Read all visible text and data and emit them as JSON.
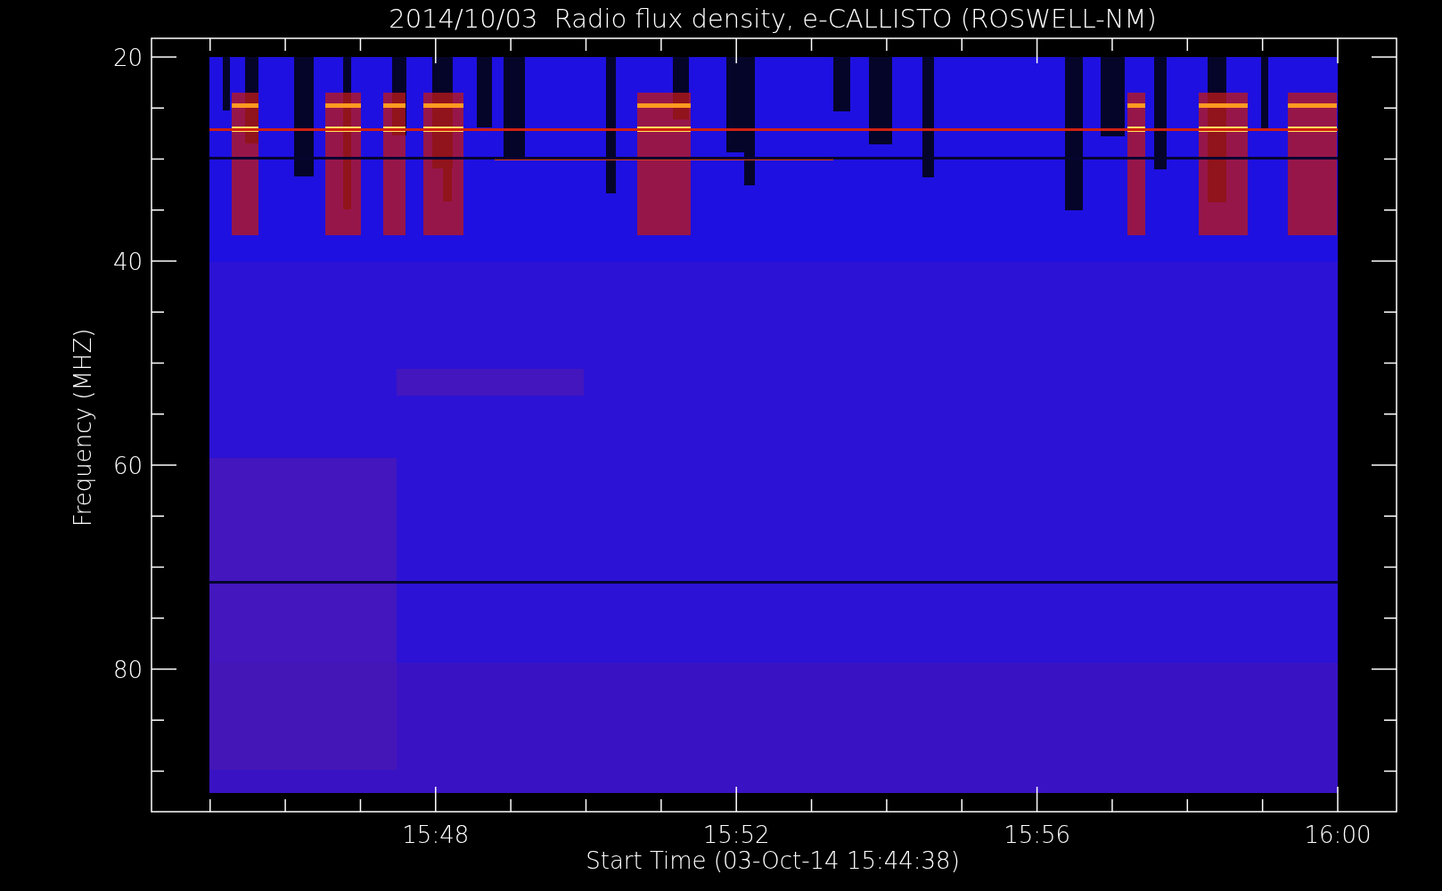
{
  "title": "2014/10/03  Radio flux density, e-CALLISTO (ROSWELL-NM)",
  "y_axis": {
    "label": "Frequency (MHZ)",
    "ticks": [
      "20",
      "40",
      "60",
      "80"
    ]
  },
  "x_axis": {
    "label": "Start Time (03-Oct-14 15:44:38)",
    "ticks": [
      "15:48",
      "15:52",
      "15:56",
      "16:00"
    ]
  }
}
